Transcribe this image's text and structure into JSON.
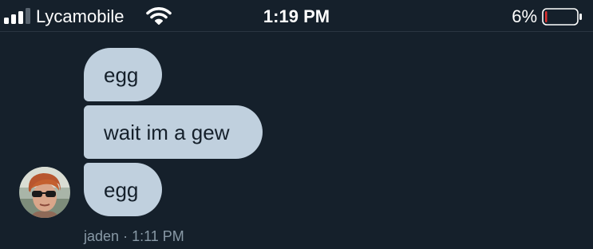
{
  "status_bar": {
    "carrier": "Lycamobile",
    "time": "1:19 PM",
    "battery_percent": "6%",
    "battery_level": 0.06,
    "signal_bars_filled": 3,
    "signal_bars_total": 4,
    "icons": [
      "signal-bars-icon",
      "wifi-icon",
      "battery-icon"
    ],
    "colors": {
      "battery_low": "#e0302f"
    }
  },
  "messages": [
    {
      "text": "egg"
    },
    {
      "text": "wait im a gew"
    },
    {
      "text": "egg"
    }
  ],
  "meta": {
    "sender": "jaden",
    "separator": "·",
    "timestamp": "1:11 PM"
  },
  "colors": {
    "background": "#15202b",
    "bubble": "#c0d0de",
    "bubble_text": "#15202b",
    "meta_text": "#8899a6"
  }
}
